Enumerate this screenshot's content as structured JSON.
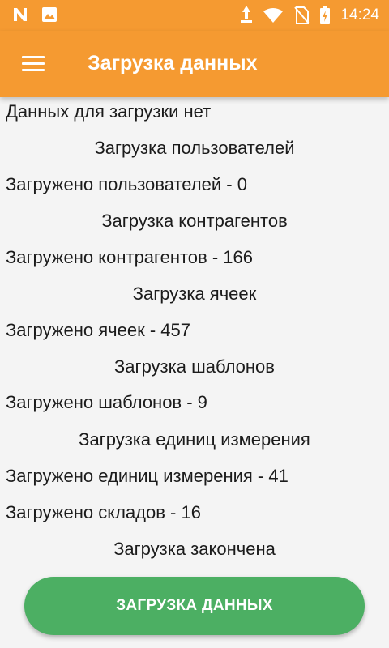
{
  "status_bar": {
    "time": "14:24",
    "icons_left": [
      "n-notification-icon",
      "image-notification-icon"
    ],
    "icons_right": [
      "upload-antenna-icon",
      "wifi-icon",
      "no-sim-icon",
      "battery-charging-icon"
    ]
  },
  "app_bar": {
    "title": "Загрузка данных",
    "menu_icon": "hamburger-menu-icon"
  },
  "log": {
    "lines": [
      {
        "text": "Данных для загрузки нет",
        "align": "left"
      },
      {
        "text": "Загрузка пользователей",
        "align": "center"
      },
      {
        "text": "Загружено пользователей - 0",
        "align": "left"
      },
      {
        "text": "Загрузка контрагентов",
        "align": "center"
      },
      {
        "text": "Загружено контрагентов - 166",
        "align": "left"
      },
      {
        "text": "Загрузка ячеек",
        "align": "center"
      },
      {
        "text": "Загружено ячеек - 457",
        "align": "left"
      },
      {
        "text": "Загрузка шаблонов",
        "align": "center"
      },
      {
        "text": "Загружено шаблонов - 9",
        "align": "left"
      },
      {
        "text": "Загрузка единиц измерения",
        "align": "center"
      },
      {
        "text": "Загружено единиц измерения - 41",
        "align": "left"
      },
      {
        "text": "Загружено складов - 16",
        "align": "left"
      },
      {
        "text": "Загрузка закончена",
        "align": "center"
      }
    ]
  },
  "button": {
    "label": "ЗАГРУЗКА ДАННЫХ"
  },
  "colors": {
    "app_bar": "#f59a31",
    "button": "#4caf63",
    "background": "#f4f4f4",
    "text": "#1b1b1b"
  }
}
